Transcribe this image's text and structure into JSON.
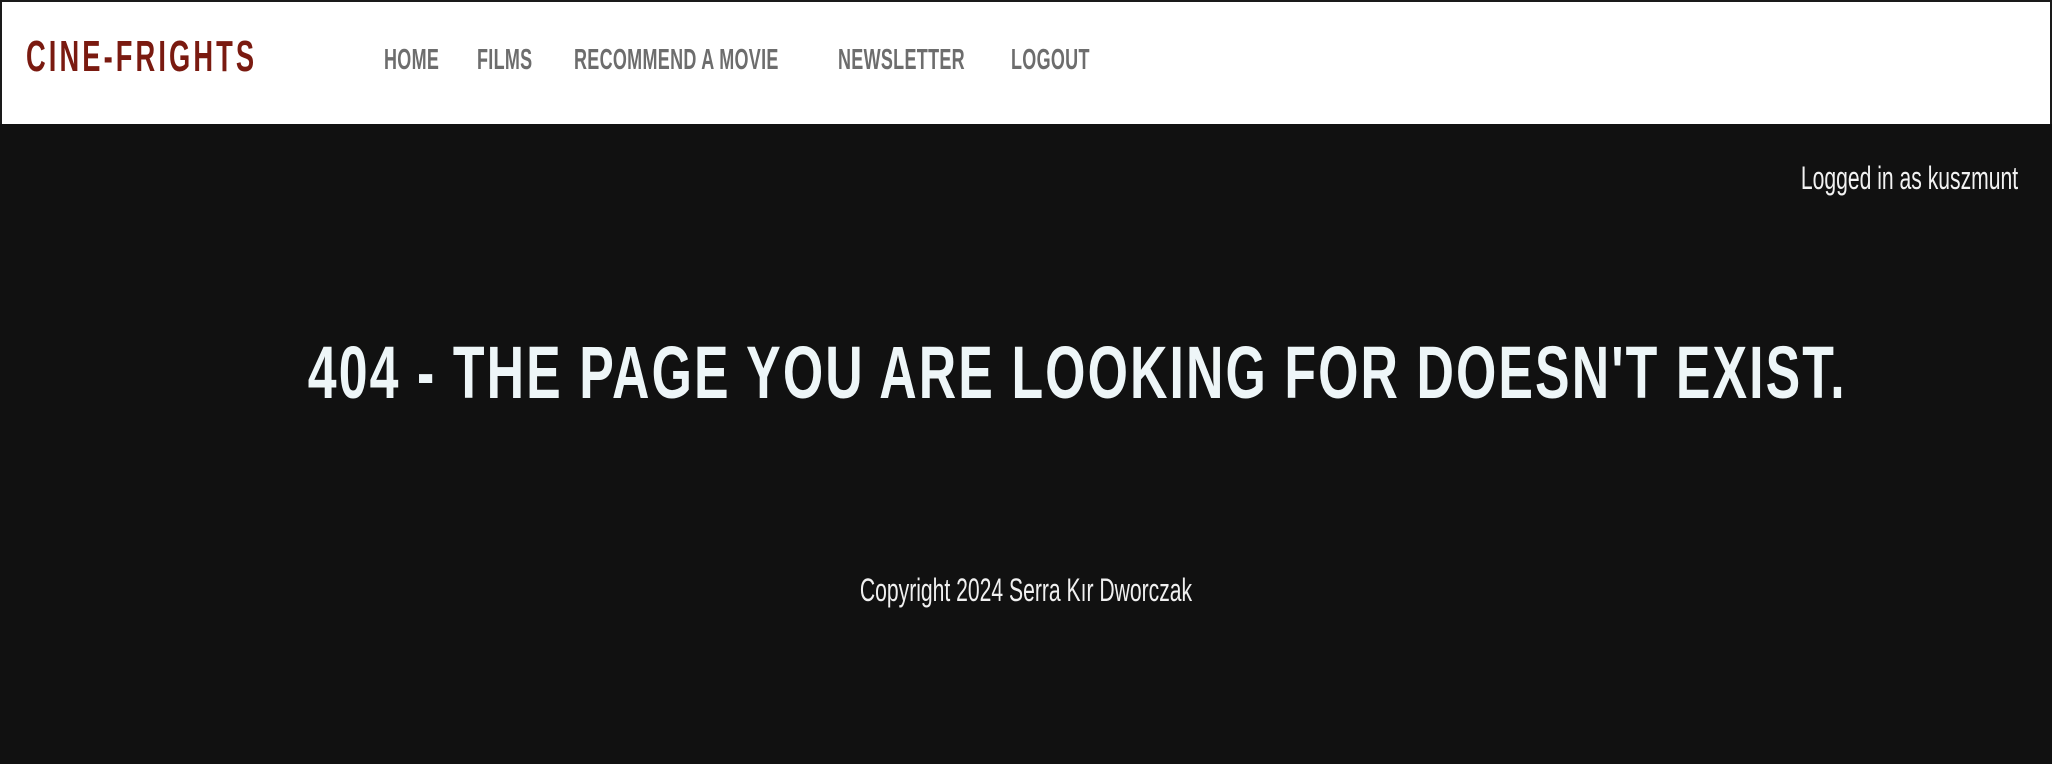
{
  "header": {
    "brand": "CINE-FRIGHTS",
    "nav": {
      "home": "HOME",
      "films": "FILMS",
      "recommend": "RECOMMEND A MOVIE",
      "newsletter": "NEWSLETTER",
      "logout": "LOGOUT"
    }
  },
  "main": {
    "login_status": "Logged in as kuszmunt",
    "error_message": "404 - THE PAGE YOU ARE LOOKING FOR DOESN'T EXIST.",
    "copyright": "Copyright 2024 Serra Kır Dworczak"
  },
  "colors": {
    "brand": "#7a1a10",
    "nav_text": "#6d6d6d",
    "header_bg": "#ffffff",
    "page_bg": "#111111",
    "text_light": "#eef6f8"
  }
}
